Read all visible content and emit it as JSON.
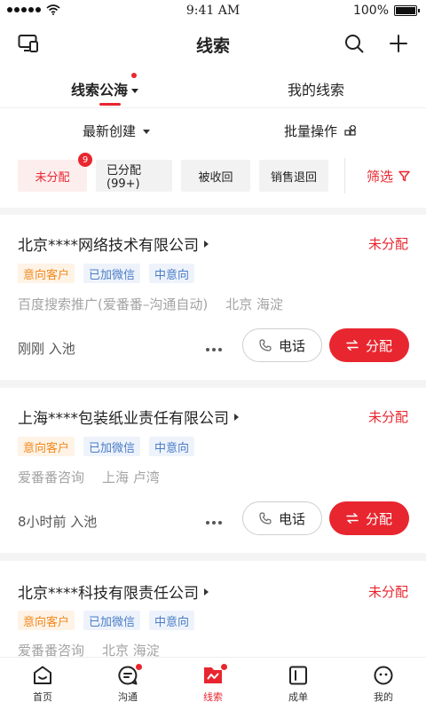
{
  "status_bar": {
    "time": "9:41 AM",
    "battery": "100%",
    "battery_level": 1.0
  },
  "nav": {
    "title": "线索"
  },
  "tabs": [
    {
      "label": "线索公海",
      "active": true,
      "has_dot": true
    },
    {
      "label": "我的线索",
      "active": false
    }
  ],
  "toolbar": {
    "sort_label": "最新创建",
    "batch_label": "批量操作",
    "filter_label": "筛选"
  },
  "chips": [
    {
      "label": "未分配",
      "active": true,
      "badge": "9"
    },
    {
      "label": "已分配(99+)"
    },
    {
      "label": "被收回"
    },
    {
      "label": "销售退回"
    }
  ],
  "leads": [
    {
      "company": "北京****网络技术有限公司",
      "status": "未分配",
      "tags": [
        "意向客户",
        "已加微信",
        "中意向"
      ],
      "source": "百度搜索推广(爱番番–沟通自动)",
      "location": "北京 海淀",
      "time": "刚刚 入池",
      "call_label": "电话",
      "assign_label": "分配"
    },
    {
      "company": "上海****包装纸业责任有限公司",
      "status": "未分配",
      "tags": [
        "意向客户",
        "已加微信",
        "中意向"
      ],
      "source": "爱番番咨询",
      "location": "上海 卢湾",
      "time": "8小时前 入池",
      "call_label": "电话",
      "assign_label": "分配"
    },
    {
      "company": "北京****科技有限责任公司",
      "status": "未分配",
      "tags": [
        "意向客户",
        "已加微信",
        "中意向"
      ],
      "source": "爱番番咨询",
      "location": "北京 海淀"
    }
  ],
  "tabbar": [
    {
      "label": "首页",
      "icon": "home-icon"
    },
    {
      "label": "沟通",
      "icon": "chat-icon",
      "has_dot": true
    },
    {
      "label": "线索",
      "icon": "leads-icon",
      "active": true,
      "has_dot": true
    },
    {
      "label": "成单",
      "icon": "deal-icon"
    },
    {
      "label": "我的",
      "icon": "profile-icon"
    }
  ],
  "colors": {
    "accent": "#e8262f",
    "tag_orange": "#f0891f",
    "tag_blue": "#4b7dc6"
  }
}
